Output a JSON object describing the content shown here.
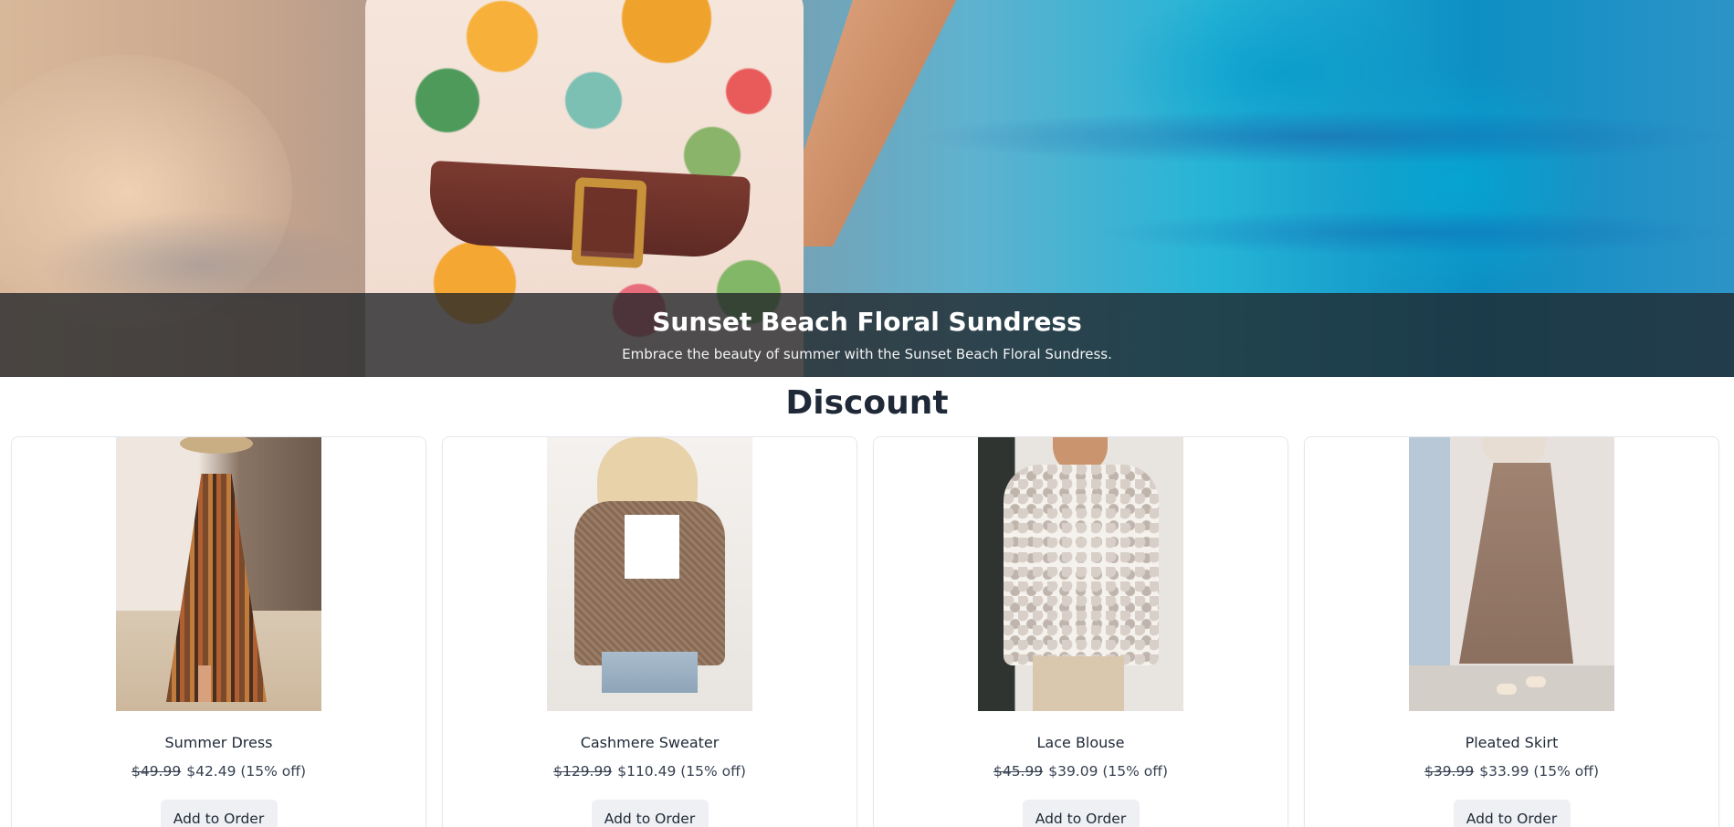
{
  "hero": {
    "title": "Sunset Beach Floral Sundress",
    "subtitle": "Embrace the beauty of summer with the Sunset Beach Floral Sundress."
  },
  "section": {
    "title": "Discount"
  },
  "products": [
    {
      "name": "Summer Dress",
      "old_price": "$49.99",
      "new_price": "$42.49 (15% off)",
      "button": "Add to Order"
    },
    {
      "name": "Cashmere Sweater",
      "old_price": "$129.99",
      "new_price": "$110.49 (15% off)",
      "button": "Add to Order"
    },
    {
      "name": "Lace Blouse",
      "old_price": "$45.99",
      "new_price": "$39.09 (15% off)",
      "button": "Add to Order"
    },
    {
      "name": "Pleated Skirt",
      "old_price": "$39.99",
      "new_price": "$33.99 (15% off)",
      "button": "Add to Order"
    }
  ],
  "colors": {
    "overlay": "#202428",
    "button_bg": "#eef0f3",
    "text": "#1f2937"
  }
}
